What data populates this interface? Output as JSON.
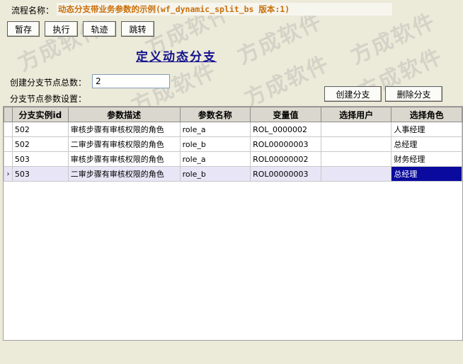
{
  "process": {
    "label": "流程名称：",
    "value": "动态分支带业务参数的示例(wf_dynamic_split_bs 版本:1)"
  },
  "toolbar": {
    "save": "暂存",
    "execute": "执行",
    "trace": "轨迹",
    "jump": "跳转"
  },
  "heading": "定义动态分支",
  "form": {
    "branch_count_label": "创建分支节点总数：",
    "branch_count_value": "2",
    "params_label": "分支节点参数设置："
  },
  "actions": {
    "create": "创建分支",
    "delete": "删除分支"
  },
  "grid": {
    "columns": [
      "分支实例id",
      "参数描述",
      "参数名称",
      "变量值",
      "选择用户",
      "选择角色"
    ],
    "rows": [
      {
        "indicator": "",
        "id": "502",
        "desc": "审核步骤有审核权限的角色",
        "name": "role_a",
        "value": "ROL_0000002",
        "user": "",
        "role": "人事经理"
      },
      {
        "indicator": "",
        "id": "502",
        "desc": "二审步骤有审核权限的角色",
        "name": "role_b",
        "value": "ROL00000003",
        "user": "",
        "role": "总经理"
      },
      {
        "indicator": "",
        "id": "503",
        "desc": "审核步骤有审核权限的角色",
        "name": "role_a",
        "value": "ROL00000002",
        "user": "",
        "role": "财务经理"
      },
      {
        "indicator": "›",
        "id": "503",
        "desc": "二审步骤有审核权限的角色",
        "name": "role_b",
        "value": "ROL00000003",
        "user": "",
        "role": "总经理"
      }
    ],
    "selected_row": 3
  },
  "watermark": "方成软件"
}
